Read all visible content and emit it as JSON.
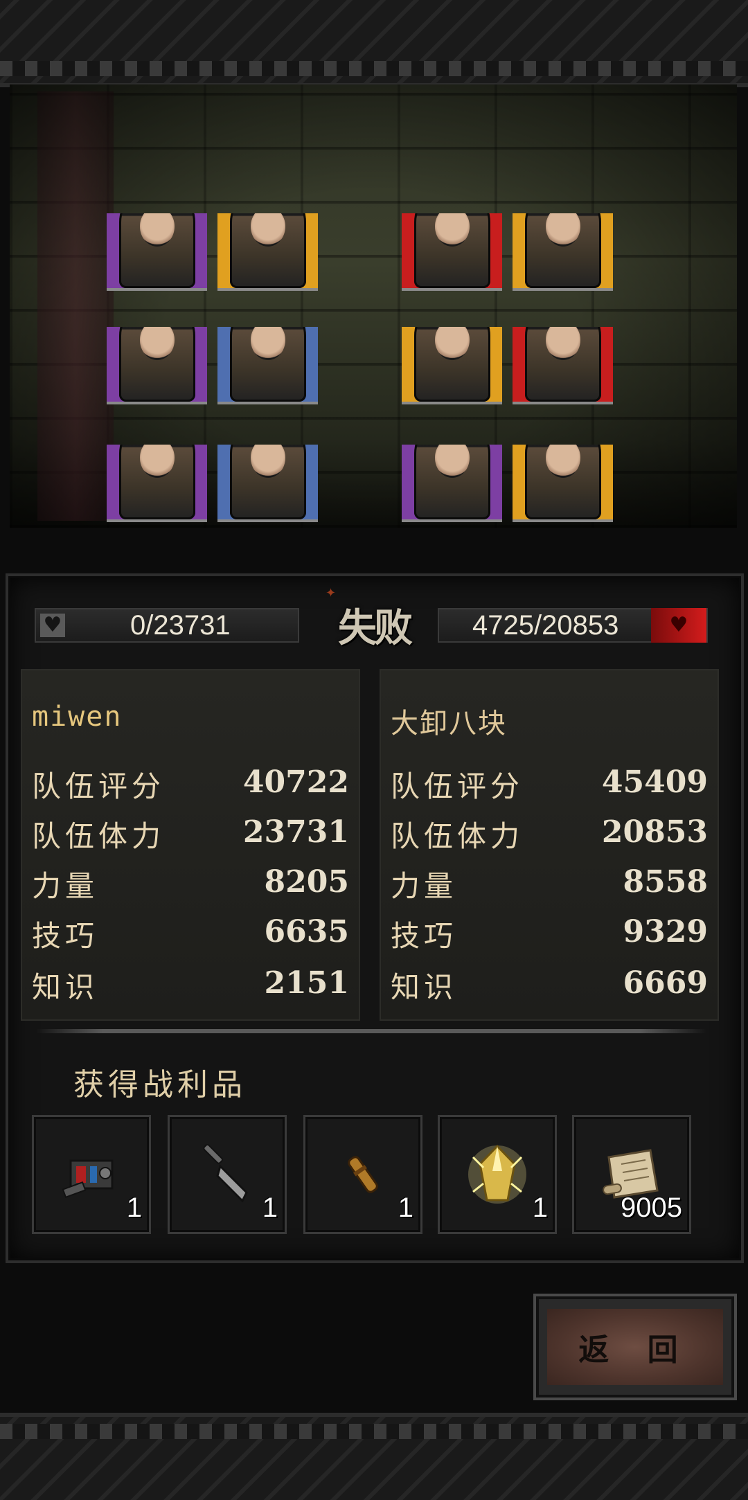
{
  "battle": {
    "result": "失败",
    "player_hp": "0/23731",
    "enemy_hp": "4725/20853",
    "player_team_colors": [
      "#7d3fa3",
      "#e0a020",
      "#7d3fa3",
      "#4f6fb0",
      "#7d3fa3",
      "#4f6fb0"
    ],
    "enemy_team_colors": [
      "#c81e1e",
      "#e0a020",
      "#e0a020",
      "#c81e1e",
      "#7d3fa3",
      "#e0a020"
    ]
  },
  "player": {
    "name": "miwen",
    "stats": [
      {
        "label": "队伍评分",
        "value": "40722"
      },
      {
        "label": "队伍体力",
        "value": "23731"
      },
      {
        "label": "力量",
        "value": "8205"
      },
      {
        "label": "技巧",
        "value": "6635"
      },
      {
        "label": "知识",
        "value": "2151"
      }
    ]
  },
  "enemy": {
    "name": "大卸八块",
    "stats": [
      {
        "label": "队伍评分",
        "value": "45409"
      },
      {
        "label": "队伍体力",
        "value": "20853"
      },
      {
        "label": "力量",
        "value": "8558"
      },
      {
        "label": "技巧",
        "value": "9329"
      },
      {
        "label": "知识",
        "value": "6669"
      }
    ]
  },
  "loot": {
    "title": "获得战利品",
    "items": [
      {
        "icon": "machine-part-icon",
        "qty": "1"
      },
      {
        "icon": "cleaver-icon",
        "qty": "1"
      },
      {
        "icon": "scroll-tube-icon",
        "qty": "1"
      },
      {
        "icon": "energy-crystal-icon",
        "qty": "1"
      },
      {
        "icon": "map-scroll-icon",
        "qty": "9005"
      }
    ]
  },
  "actions": {
    "return_label": "返 回"
  }
}
